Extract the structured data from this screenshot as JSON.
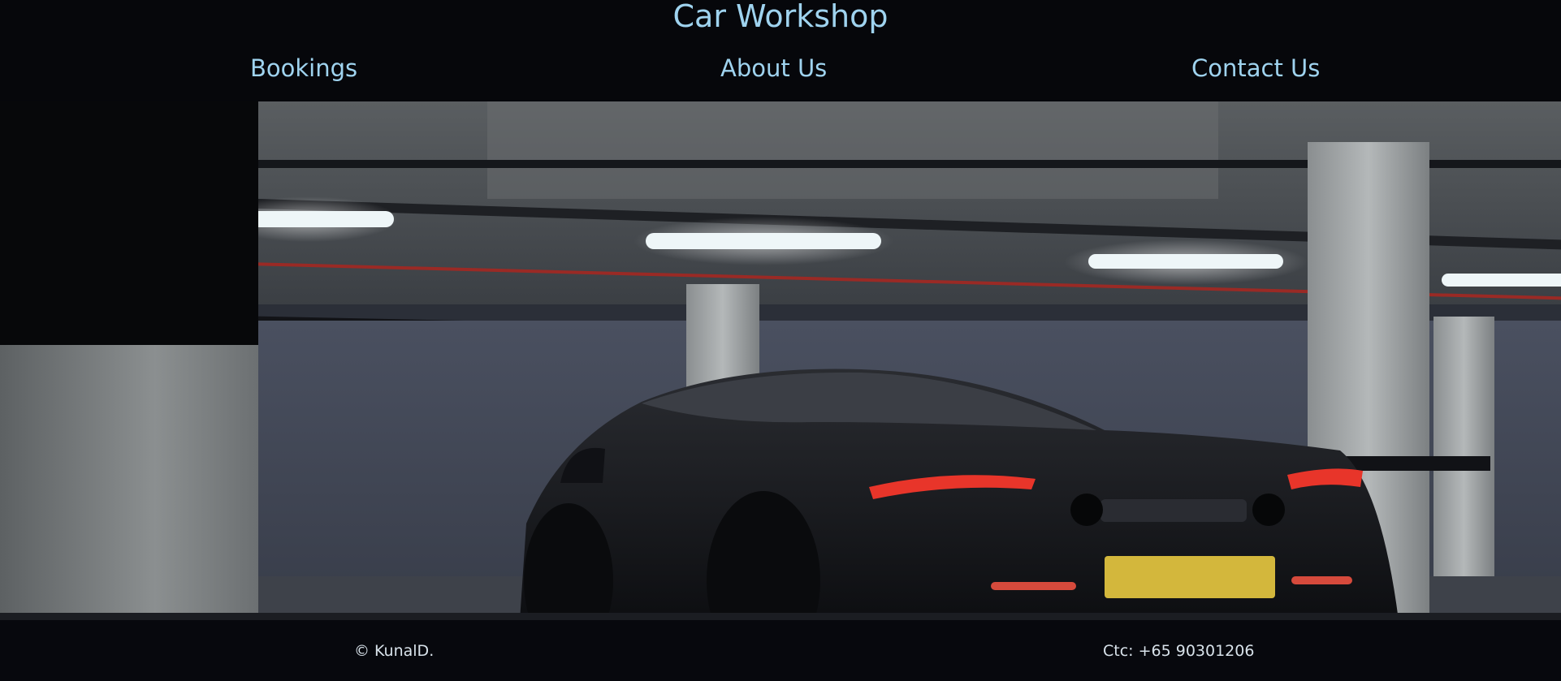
{
  "header": {
    "title": "Car Workshop",
    "nav": [
      {
        "label": "Bookings"
      },
      {
        "label": "About Us"
      },
      {
        "label": "Contact Us"
      }
    ]
  },
  "hero": {
    "image_subject": "dark supercar in underground car park"
  },
  "footer": {
    "copyright": "© KunalD.",
    "contact": "Ctc: +65 90301206"
  },
  "colors": {
    "background": "#07080d",
    "accent_text": "#9fd3ef",
    "footer_text": "#d8e2ea",
    "plate": "#d3b73c",
    "tail_light": "#e8352a"
  }
}
